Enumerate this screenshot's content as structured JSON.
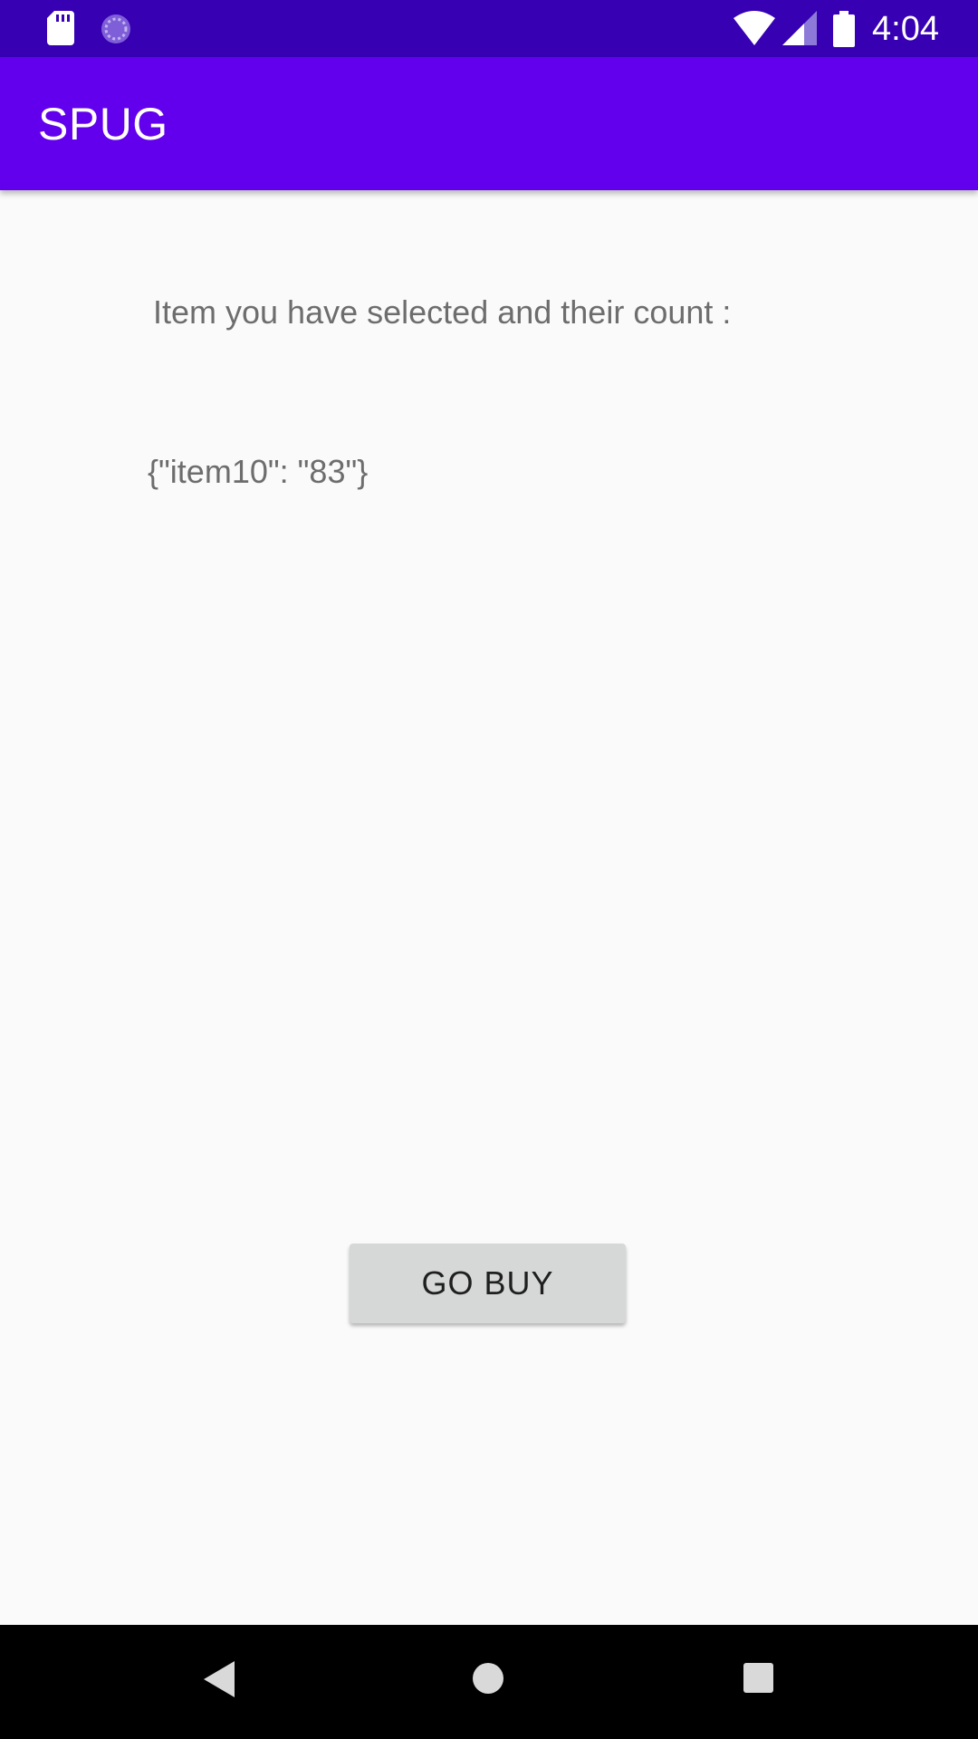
{
  "status_bar": {
    "time": "4:04",
    "icons": [
      "sd-card-icon",
      "sync-icon",
      "wifi-icon",
      "cell-signal-icon",
      "battery-icon"
    ]
  },
  "app_bar": {
    "title": "SPUG"
  },
  "main": {
    "heading": "Item you have selected and their count :",
    "selection": "{\"item10\": \"83\"}",
    "buy_label": "GO BUY"
  },
  "nav_bar": {
    "icons": [
      "back-icon",
      "home-icon",
      "recents-icon"
    ]
  },
  "colors": {
    "status_bar": "#3700b3",
    "app_bar": "#6200ee",
    "background": "#fafafa",
    "text": "#6d6d6d",
    "button": "#d6d7d7",
    "nav_bar": "#000000"
  }
}
